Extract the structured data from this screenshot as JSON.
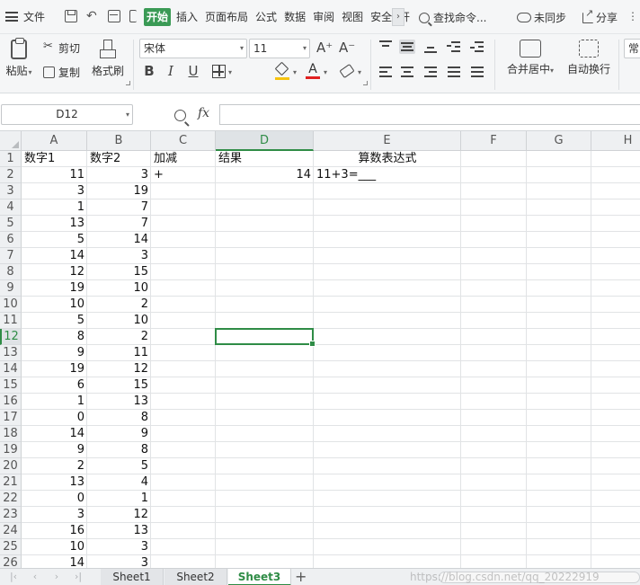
{
  "menu": {
    "file_label": "文件",
    "tabs": [
      "开始",
      "插入",
      "页面布局",
      "公式",
      "数据",
      "审阅",
      "视图",
      "安全",
      "开"
    ],
    "active_tab": "开始",
    "more_arrow": "›",
    "search_label": "查找命令...",
    "sync_label": "未同步",
    "share_label": "分享",
    "more_label": "⋮"
  },
  "ribbon": {
    "paste_label": "粘贴",
    "cut_label": "剪切",
    "copy_label": "复制",
    "format_painter_label": "格式刷",
    "font_name": "宋体",
    "font_size": "11",
    "grow_font": "A⁺",
    "shrink_font": "A⁻",
    "bold": "B",
    "italic": "I",
    "underline": "U",
    "font_color_glyph": "A",
    "merge_label": "合并居中",
    "wrap_label": "自动换行",
    "number_format_label": "常"
  },
  "formula_bar": {
    "name_box": "D12",
    "fx_label": "fx",
    "content": ""
  },
  "grid": {
    "columns": [
      "A",
      "B",
      "C",
      "D",
      "E",
      "F",
      "G",
      "H"
    ],
    "active_column": "D",
    "active_row": 12,
    "selected_cell": "D12",
    "header_row": [
      "数字1",
      "数字2",
      "加减",
      "结果",
      "算数表达式"
    ],
    "row2": {
      "op": "+",
      "result": "14",
      "expression": "11+3=___"
    },
    "rows": [
      {
        "n": 1
      },
      {
        "n": 2,
        "a": "11",
        "b": "3"
      },
      {
        "n": 3,
        "a": "3",
        "b": "19"
      },
      {
        "n": 4,
        "a": "1",
        "b": "7"
      },
      {
        "n": 5,
        "a": "13",
        "b": "7"
      },
      {
        "n": 6,
        "a": "5",
        "b": "14"
      },
      {
        "n": 7,
        "a": "14",
        "b": "3"
      },
      {
        "n": 8,
        "a": "12",
        "b": "15"
      },
      {
        "n": 9,
        "a": "19",
        "b": "10"
      },
      {
        "n": 10,
        "a": "10",
        "b": "2"
      },
      {
        "n": 11,
        "a": "5",
        "b": "10"
      },
      {
        "n": 12,
        "a": "8",
        "b": "2"
      },
      {
        "n": 13,
        "a": "9",
        "b": "11"
      },
      {
        "n": 14,
        "a": "19",
        "b": "12"
      },
      {
        "n": 15,
        "a": "6",
        "b": "15"
      },
      {
        "n": 16,
        "a": "1",
        "b": "13"
      },
      {
        "n": 17,
        "a": "0",
        "b": "8"
      },
      {
        "n": 18,
        "a": "14",
        "b": "9"
      },
      {
        "n": 19,
        "a": "9",
        "b": "8"
      },
      {
        "n": 20,
        "a": "2",
        "b": "5"
      },
      {
        "n": 21,
        "a": "13",
        "b": "4"
      },
      {
        "n": 22,
        "a": "0",
        "b": "1"
      },
      {
        "n": 23,
        "a": "3",
        "b": "12"
      },
      {
        "n": 24,
        "a": "16",
        "b": "13"
      },
      {
        "n": 25,
        "a": "10",
        "b": "3"
      },
      {
        "n": 26,
        "a": "14",
        "b": "3"
      }
    ]
  },
  "sheets": {
    "tabs": [
      "Sheet1",
      "Sheet2",
      "Sheet3"
    ],
    "active": "Sheet3",
    "add_label": "+",
    "nav": [
      "|‹",
      "‹",
      "›",
      "›|"
    ]
  },
  "watermark": "https://blog.csdn.net/qq_20222919",
  "colors": {
    "accent": "#2f8c46",
    "active_tab_bg": "#3a9a55",
    "fill_color_bar": "#f6c30f",
    "font_color_bar": "#e02020"
  }
}
